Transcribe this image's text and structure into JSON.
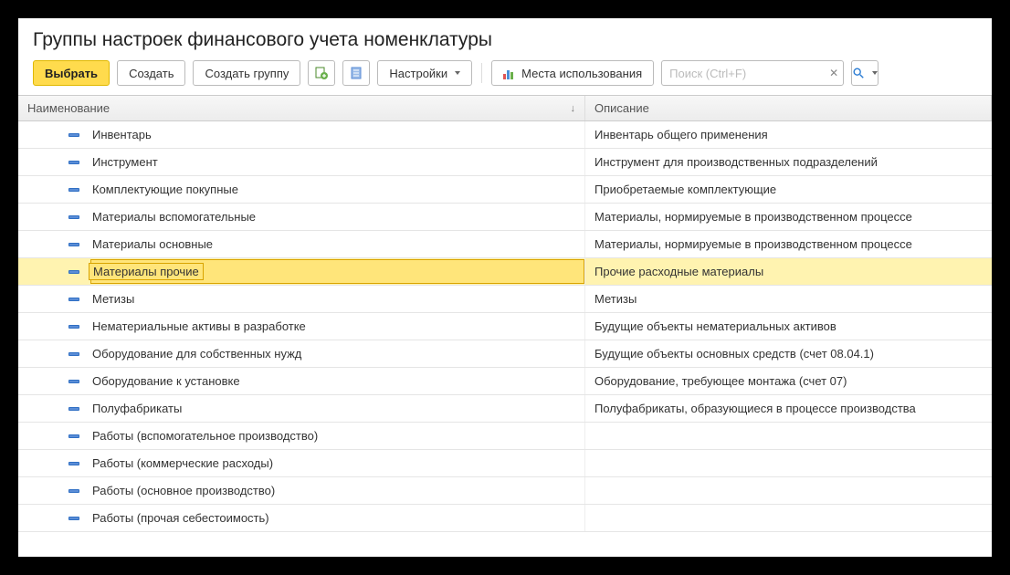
{
  "title": "Группы настроек финансового учета номенклатуры",
  "toolbar": {
    "select": "Выбрать",
    "create": "Создать",
    "create_group": "Создать группу",
    "settings": "Настройки",
    "usage": "Места использования"
  },
  "search": {
    "placeholder": "Поиск (Ctrl+F)"
  },
  "columns": {
    "name": "Наименование",
    "desc": "Описание"
  },
  "selected_index": 5,
  "rows": [
    {
      "name": "Инвентарь",
      "desc": "Инвентарь общего применения"
    },
    {
      "name": "Инструмент",
      "desc": "Инструмент для производственных подразделений"
    },
    {
      "name": "Комплектующие покупные",
      "desc": "Приобретаемые комплектующие"
    },
    {
      "name": "Материалы вспомогательные",
      "desc": "Материалы, нормируемые в производственном процессе"
    },
    {
      "name": "Материалы основные",
      "desc": "Материалы, нормируемые в производственном процессе"
    },
    {
      "name": "Материалы прочие",
      "desc": "Прочие расходные материалы"
    },
    {
      "name": "Метизы",
      "desc": "Метизы"
    },
    {
      "name": "Нематериальные активы в разработке",
      "desc": "Будущие объекты нематериальных активов"
    },
    {
      "name": "Оборудование для собственных нужд",
      "desc": "Будущие объекты основных средств (счет 08.04.1)"
    },
    {
      "name": "Оборудование к установке",
      "desc": "Оборудование, требующее монтажа (счет 07)"
    },
    {
      "name": "Полуфабрикаты",
      "desc": "Полуфабрикаты, образующиеся в процессе производства"
    },
    {
      "name": "Работы (вспомогательное производство)",
      "desc": ""
    },
    {
      "name": "Работы (коммерческие расходы)",
      "desc": ""
    },
    {
      "name": "Работы (основное производство)",
      "desc": ""
    },
    {
      "name": "Работы (прочая себестоимость)",
      "desc": ""
    }
  ]
}
